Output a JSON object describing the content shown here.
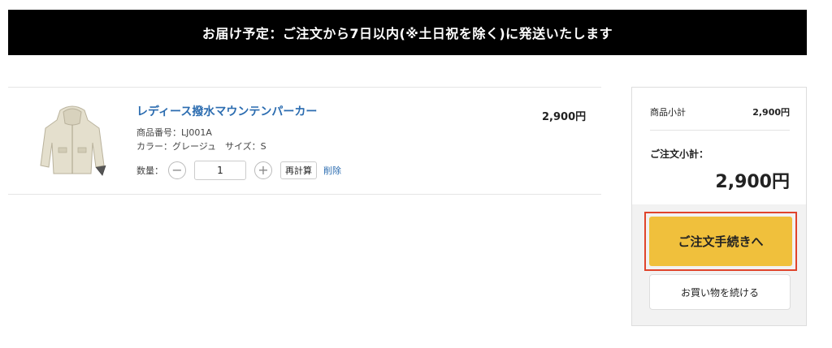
{
  "banner": {
    "text": "お届け予定：ご注文から7日以内(※土日祝を除く)に発送いたします"
  },
  "cart_item": {
    "title": "レディース撥水マウンテンパーカー",
    "sku": "商品番号：LJ001A",
    "color_size": "カラー：グレージュ　サイズ：S",
    "price": "2,900円",
    "quantity_label": "数量：",
    "quantity": "1",
    "minus": "−",
    "plus": "+",
    "recalc": "再計算",
    "delete": "削除"
  },
  "summary": {
    "subtotal_label": "商品小計",
    "subtotal_value": "2,900円",
    "order_subtotal_label": "ご注文小計：",
    "order_subtotal_value": "2,900円",
    "checkout_button": "ご注文手続きへ",
    "continue_button": "お買い物を続ける"
  },
  "colors": {
    "banner_bg": "#000000",
    "link_blue": "#2b6cb0",
    "checkout_yellow": "#f0c03c",
    "highlight_red": "#e0442c"
  }
}
